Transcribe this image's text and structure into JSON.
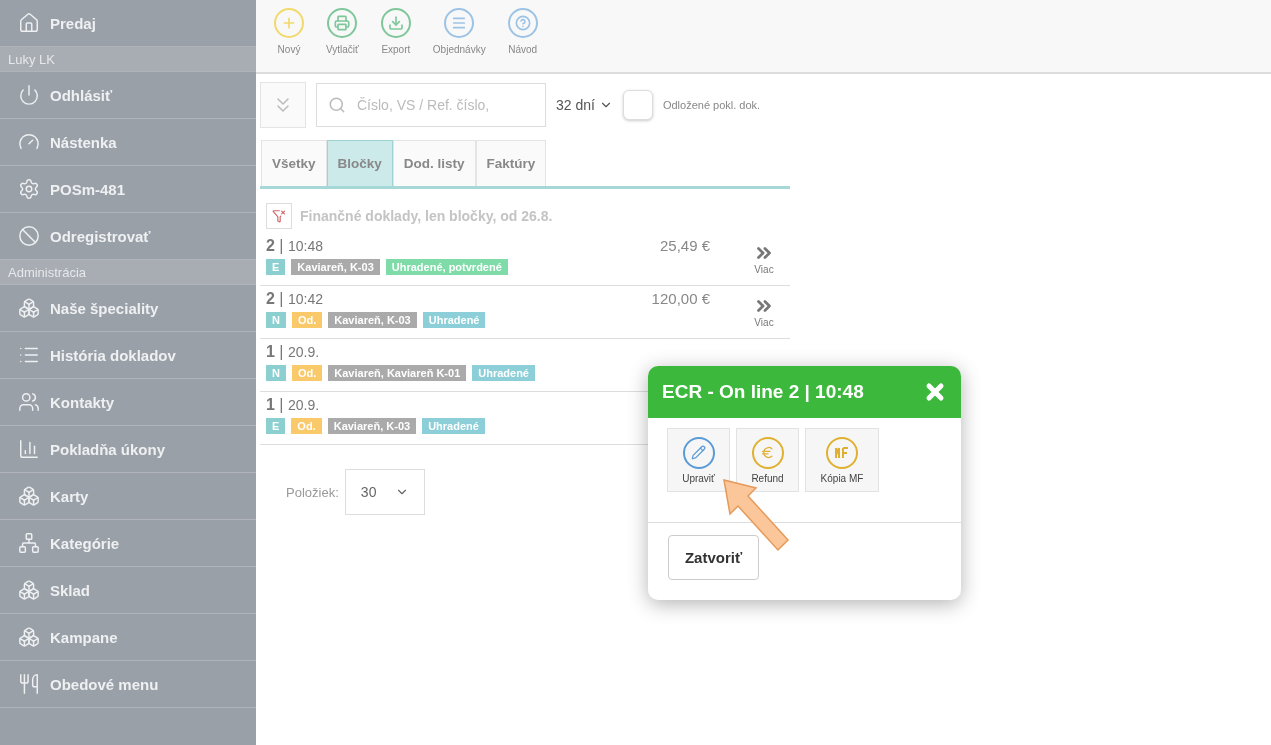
{
  "sidebar": {
    "items": [
      {
        "kind": "item",
        "label": "Predaj"
      },
      {
        "kind": "section",
        "label": "Luky LK"
      },
      {
        "kind": "item",
        "label": "Odhlásiť"
      },
      {
        "kind": "item",
        "label": "Nástenka"
      },
      {
        "kind": "item",
        "label": "POSm-481"
      },
      {
        "kind": "item",
        "label": "Odregistrovať"
      },
      {
        "kind": "section",
        "label": "Administrácia"
      },
      {
        "kind": "item",
        "label": "Naše špeciality"
      },
      {
        "kind": "item",
        "label": "História dokladov"
      },
      {
        "kind": "item",
        "label": "Kontakty"
      },
      {
        "kind": "item",
        "label": "Pokladňa úkony"
      },
      {
        "kind": "item",
        "label": "Karty"
      },
      {
        "kind": "item",
        "label": "Kategórie"
      },
      {
        "kind": "item",
        "label": "Sklad"
      },
      {
        "kind": "item",
        "label": "Kampane"
      },
      {
        "kind": "item",
        "label": "Obedové menu"
      }
    ]
  },
  "toolbar": [
    {
      "label": "Nový",
      "color": "#f2d96b"
    },
    {
      "label": "Vytlačiť",
      "color": "#7fc79a"
    },
    {
      "label": "Export",
      "color": "#7fc79a"
    },
    {
      "label": "Objednávky",
      "color": "#9cc3e6"
    },
    {
      "label": "Návod",
      "color": "#9cc3e6"
    }
  ],
  "filter": {
    "search_placeholder": "Číslo, VS / Ref. číslo,",
    "period": "32 dní",
    "postponed": {
      "label": "Odložené pokl. dok.",
      "checked": false
    }
  },
  "tabs": [
    {
      "label": "Všetky",
      "selected": false
    },
    {
      "label": "Bločky",
      "selected": true
    },
    {
      "label": "Dod. listy",
      "selected": false
    },
    {
      "label": "Faktúry",
      "selected": false
    }
  ],
  "filter_summary": "Finančné doklady, len bločky, od 26.8.",
  "records": [
    {
      "number": "2",
      "separator": "|",
      "time": "10:48",
      "amount": "25,49 €",
      "more": "Viac",
      "tags": [
        {
          "text": "E",
          "color": "#8ccfd0"
        },
        {
          "text": "Kaviareň, K-03",
          "color": "#aaaaaa"
        },
        {
          "text": "Uhradené, potvrdené",
          "color": "#7fdca8"
        }
      ]
    },
    {
      "number": "2",
      "separator": "|",
      "time": "10:42",
      "amount": "120,00 €",
      "more": "Viac",
      "tags": [
        {
          "text": "N",
          "color": "#8ccfd0"
        },
        {
          "text": "Od.",
          "color": "#f9c96a"
        },
        {
          "text": "Kaviareň, K-03",
          "color": "#aaaaaa"
        },
        {
          "text": "Uhradené",
          "color": "#8ccfd8"
        }
      ]
    },
    {
      "number": "1",
      "separator": "|",
      "time": "20.9.",
      "tags": [
        {
          "text": "N",
          "color": "#8ccfd0"
        },
        {
          "text": "Od.",
          "color": "#f9c96a"
        },
        {
          "text": "Kaviareň, Kaviareň K-01",
          "color": "#aaaaaa"
        },
        {
          "text": "Uhradené",
          "color": "#8ccfd8"
        }
      ]
    },
    {
      "number": "1",
      "separator": "|",
      "time": "20.9.",
      "tags": [
        {
          "text": "E",
          "color": "#8ccfd0"
        },
        {
          "text": "Od.",
          "color": "#f9c96a"
        },
        {
          "text": "Kaviareň, K-03",
          "color": "#aaaaaa"
        },
        {
          "text": "Uhradené",
          "color": "#8ccfd8"
        }
      ]
    }
  ],
  "pager": {
    "label": "Položiek:",
    "value": "30"
  },
  "dialog": {
    "title": "ECR - On line 2 | 10:48",
    "actions": [
      {
        "label": "Upraviť",
        "color": "#5b9bd5"
      },
      {
        "label": "Refund",
        "color": "#e0b030"
      },
      {
        "label": "Kópia MF",
        "color": "#e0b030"
      }
    ],
    "close": "Zatvoriť"
  }
}
